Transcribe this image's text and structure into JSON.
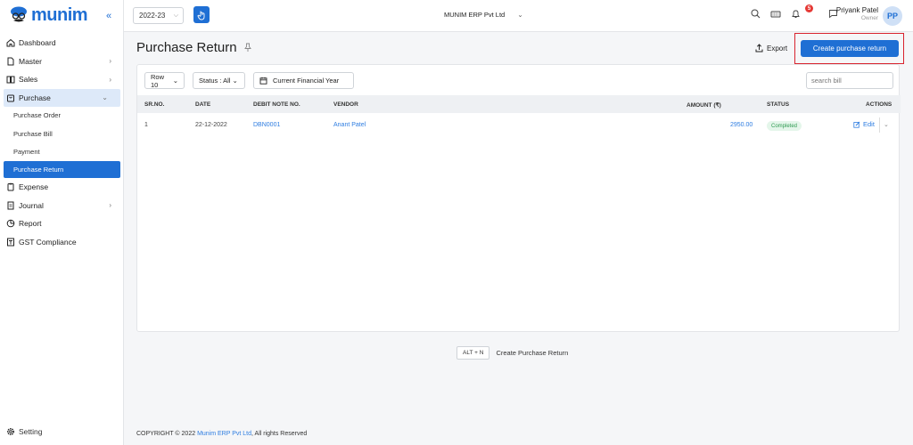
{
  "app": {
    "logo_text": "munim",
    "collapse_glyph": "«"
  },
  "sidebar": {
    "items": [
      {
        "label": "Dashboard",
        "icon": "home-icon"
      },
      {
        "label": "Master",
        "icon": "file-icon"
      },
      {
        "label": "Sales",
        "icon": "book-icon"
      },
      {
        "label": "Purchase",
        "icon": "cart-icon"
      },
      {
        "label": "Expense",
        "icon": "clipboard-icon"
      },
      {
        "label": "Journal",
        "icon": "journal-icon"
      },
      {
        "label": "Report",
        "icon": "pie-chart-icon"
      },
      {
        "label": "GST Compliance",
        "icon": "gst-icon"
      }
    ],
    "purchase_sub": [
      "Purchase Order",
      "Purchase Bill",
      "Payment",
      "Purchase Return"
    ],
    "setting_label": "Setting"
  },
  "topbar": {
    "financial_year": "2022-23",
    "company": "MUNIM ERP Pvt Ltd",
    "notification_count": "5",
    "user_name": "Priyank Patel",
    "user_role": "Owner",
    "avatar_initials": "PP"
  },
  "page": {
    "title": "Purchase Return",
    "export_label": "Export",
    "create_label": "Create purchase return"
  },
  "filters": {
    "rows": "Row 10",
    "status": "Status : All",
    "period": "Current Financial Year",
    "search_placeholder": "search bill"
  },
  "table": {
    "headers": [
      "SR.NO.",
      "DATE",
      "DEBIT NOTE NO.",
      "VENDOR",
      "AMOUNT (₹)",
      "STATUS",
      "ACTIONS"
    ],
    "rows": [
      {
        "sr": "1",
        "date": "22-12-2022",
        "debit_note": "DBN0001",
        "vendor": "Anant Patel",
        "amount": "2950.00",
        "status": "Completed",
        "action": "Edit"
      }
    ]
  },
  "shortcut": {
    "key": "ALT + N",
    "label": "Create Purchase Return"
  },
  "footer": {
    "prefix": "COPYRIGHT © 2022 ",
    "company": "Munim ERP Pvt Ltd",
    "suffix": ", All rights Reserved"
  },
  "colors": {
    "accent": "#1f6fd4",
    "highlight_border": "#d9232e",
    "completed_bg": "#e4f6ea",
    "completed_text": "#2e9a51"
  }
}
